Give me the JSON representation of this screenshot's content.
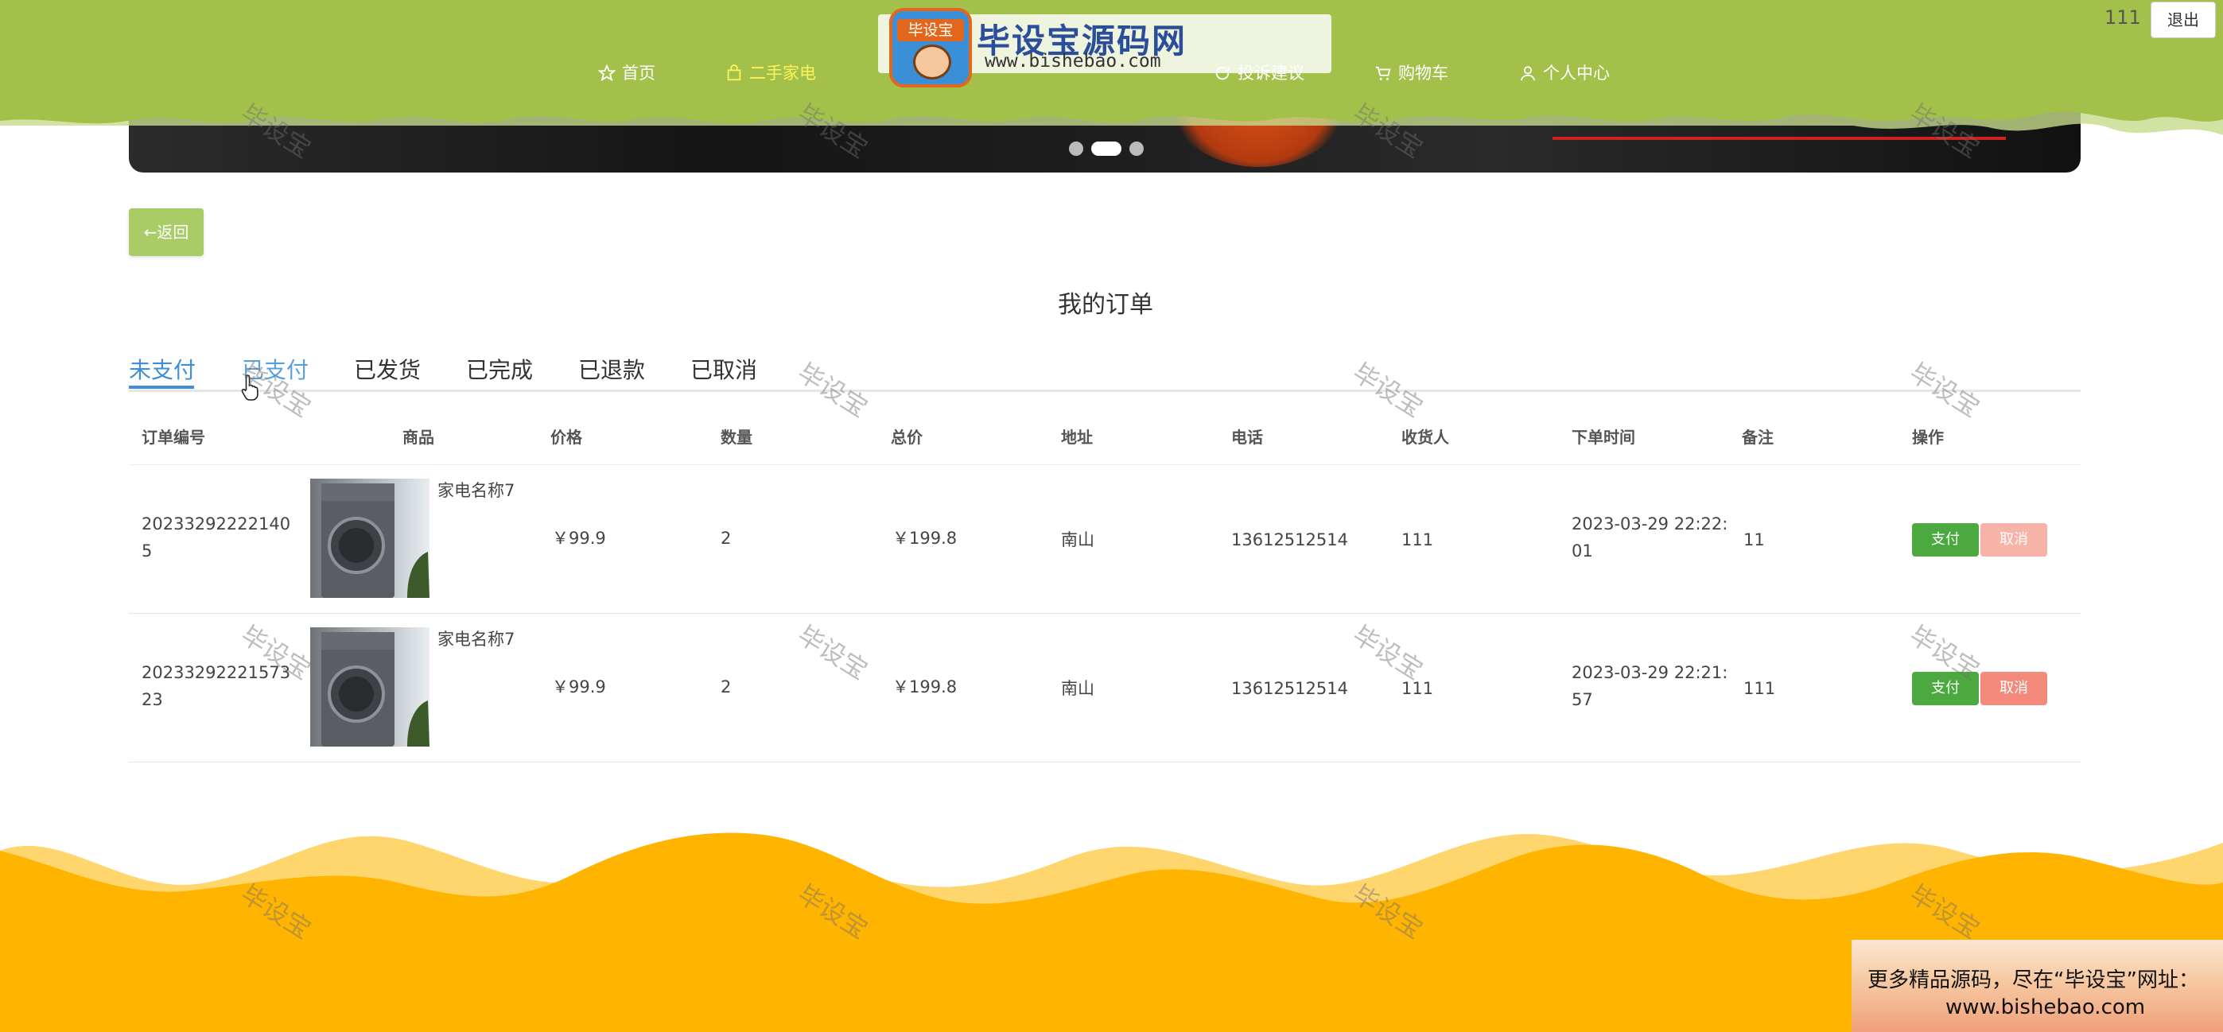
{
  "header": {
    "logo_text": "毕设宝源码网",
    "logo_badge": "毕设宝",
    "logo_url": "www.bishebao.com",
    "nav": [
      {
        "label": "首页",
        "icon": "star-icon"
      },
      {
        "label": "二手家电",
        "icon": "bag-icon",
        "active": true
      },
      {
        "label": "投诉建议",
        "icon": "refresh-icon"
      },
      {
        "label": "购物车",
        "icon": "cart-icon"
      },
      {
        "label": "个人中心",
        "icon": "user-icon"
      }
    ],
    "username": "111",
    "logout_label": "退出"
  },
  "back_label": "←返回",
  "page_title": "我的订单",
  "tabs": [
    "未支付",
    "已支付",
    "已发货",
    "已完成",
    "已退款",
    "已取消"
  ],
  "table": {
    "columns": [
      "订单编号",
      "商品",
      "价格",
      "数量",
      "总价",
      "地址",
      "电话",
      "收货人",
      "下单时间",
      "备注",
      "操作"
    ],
    "rows": [
      {
        "order_no_line1": "20233292222140",
        "order_no_line2": "5",
        "product": "家电名称7",
        "price": "￥99.9",
        "qty": "2",
        "total": "￥199.8",
        "address": "南山",
        "phone": "13612512514",
        "receiver": "111",
        "time_line1": "2023-03-29 22:22:",
        "time_line2": "01",
        "note": "11",
        "pay_label": "支付",
        "cancel_label": "取消"
      },
      {
        "order_no_line1": "20233292221573",
        "order_no_line2": "23",
        "product": "家电名称7",
        "price": "￥99.9",
        "qty": "2",
        "total": "￥199.8",
        "address": "南山",
        "phone": "13612512514",
        "receiver": "111",
        "time_line1": "2023-03-29 22:21:",
        "time_line2": "57",
        "note": "111",
        "pay_label": "支付",
        "cancel_label": "取消"
      }
    ]
  },
  "promo": {
    "line1": "更多精品源码，尽在“毕设宝”网址：",
    "line2": "www.bishebao.com"
  },
  "watermark": "毕设宝",
  "colors": {
    "header_green": "#a3c14a",
    "active_tab": "#3e8fd8",
    "pay_button": "#4ca93f",
    "cancel_button": "#f38a7b",
    "footer_yellow": "#ffb400"
  }
}
